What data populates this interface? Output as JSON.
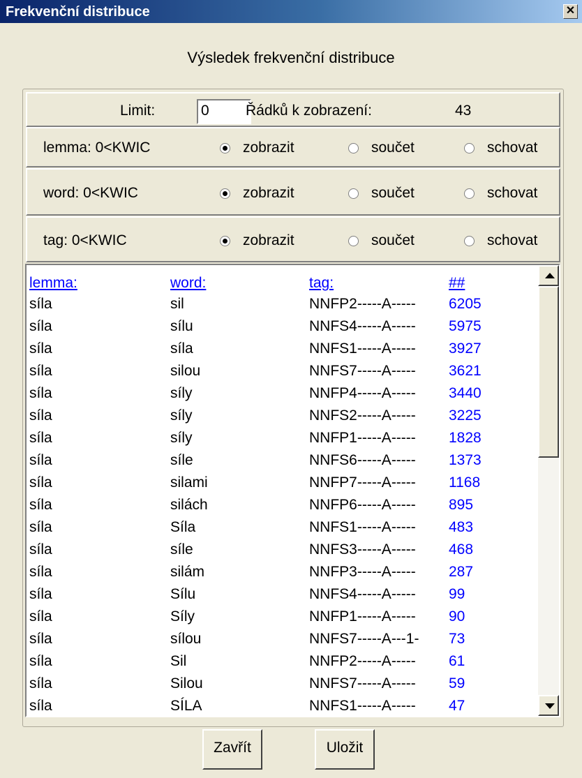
{
  "window": {
    "title": "Frekvenční distribuce"
  },
  "heading": "Výsledek frekvenční distribuce",
  "limit": {
    "label": "Limit:",
    "value": "0",
    "rows_label": "Řádků k zobrazení:",
    "rows_value": "43"
  },
  "groups": [
    {
      "label": "lemma: 0<KWIC",
      "options": [
        "zobrazit",
        "součet",
        "schovat"
      ],
      "selected": 0
    },
    {
      "label": "word: 0<KWIC",
      "options": [
        "zobrazit",
        "součet",
        "schovat"
      ],
      "selected": 0
    },
    {
      "label": "tag: 0<KWIC",
      "options": [
        "zobrazit",
        "součet",
        "schovat"
      ],
      "selected": 0
    }
  ],
  "table": {
    "headers": [
      "lemma:",
      "word:",
      "tag:",
      "##"
    ],
    "rows": [
      [
        "síla",
        "sil",
        "NNFP2-----A-----",
        "6205"
      ],
      [
        "síla",
        "sílu",
        "NNFS4-----A-----",
        "5975"
      ],
      [
        "síla",
        "síla",
        "NNFS1-----A-----",
        "3927"
      ],
      [
        "síla",
        "silou",
        "NNFS7-----A-----",
        "3621"
      ],
      [
        "síla",
        "síly",
        "NNFP4-----A-----",
        "3440"
      ],
      [
        "síla",
        "síly",
        "NNFS2-----A-----",
        "3225"
      ],
      [
        "síla",
        "síly",
        "NNFP1-----A-----",
        "1828"
      ],
      [
        "síla",
        "síle",
        "NNFS6-----A-----",
        "1373"
      ],
      [
        "síla",
        "silami",
        "NNFP7-----A-----",
        "1168"
      ],
      [
        "síla",
        "silách",
        "NNFP6-----A-----",
        "895"
      ],
      [
        "síla",
        "Síla",
        "NNFS1-----A-----",
        "483"
      ],
      [
        "síla",
        "síle",
        "NNFS3-----A-----",
        "468"
      ],
      [
        "síla",
        "silám",
        "NNFP3-----A-----",
        "287"
      ],
      [
        "síla",
        "Sílu",
        "NNFS4-----A-----",
        "99"
      ],
      [
        "síla",
        "Síly",
        "NNFP1-----A-----",
        "90"
      ],
      [
        "síla",
        "sílou",
        "NNFS7-----A---1-",
        "73"
      ],
      [
        "síla",
        "Sil",
        "NNFP2-----A-----",
        "61"
      ],
      [
        "síla",
        "Silou",
        "NNFS7-----A-----",
        "59"
      ],
      [
        "síla",
        "SÍLA",
        "NNFS1-----A-----",
        "47"
      ]
    ]
  },
  "buttons": {
    "close": "Zavřít",
    "save": "Uložit"
  }
}
